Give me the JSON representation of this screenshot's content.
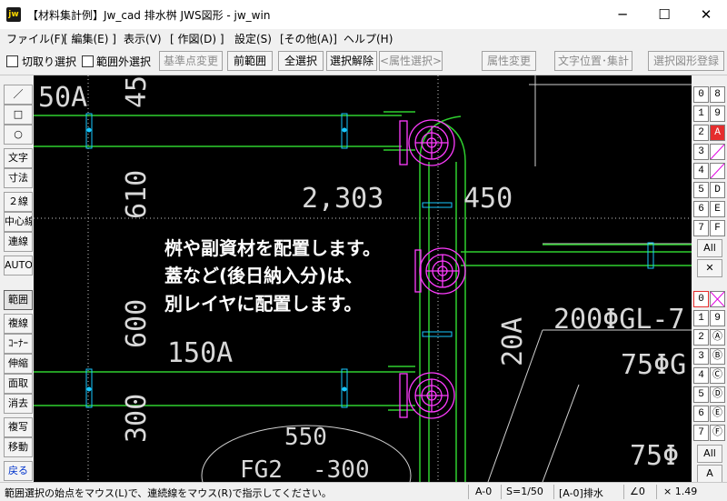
{
  "window": {
    "title": "【材料集計例】Jw_cad 排水桝 JWS図形 - jw_win",
    "app_icon": "jw",
    "controls": {
      "minimize": "─",
      "maximize": "☐",
      "close": "✕"
    }
  },
  "menu": [
    "ファイル(F)",
    "[ 編集(E) ]",
    "表示(V)",
    "[ 作図(D) ]",
    "設定(S)",
    "[その他(A)]",
    "ヘルプ(H)"
  ],
  "toolbar": {
    "checkbox_crop": "切取り選択",
    "checkbox_outside": "範囲外選択",
    "base_point": "基準点変更",
    "prev_range": "前範囲",
    "select_all": "全選択",
    "deselect": "選択解除",
    "attr_select": "<属性選択>",
    "attr_change": "属性変更",
    "text_pos": "文字位置･集計",
    "register": "選択図形登録"
  },
  "left_tools": [
    "／",
    "□",
    "○",
    "文字",
    "寸法",
    "２線",
    "中心線",
    "連線",
    "AUTO",
    "範囲",
    "複線",
    "ｺｰﾅｰ",
    "伸縮",
    "面取",
    "消去",
    "複写",
    "移動",
    "戻る"
  ],
  "right_groups": {
    "layer_groups": [
      "0",
      "1",
      "2",
      "3",
      "4",
      "5",
      "6",
      "7"
    ],
    "layer_groups_right": [
      "8",
      "9",
      "A",
      "",
      "",
      "D",
      "E",
      "F"
    ],
    "all_label": "All",
    "x_label": "✕",
    "layers": [
      "0",
      "1",
      "2",
      "3",
      "4",
      "5",
      "6",
      "7"
    ],
    "layers_right": [
      "",
      "9",
      "Ⓐ",
      "Ⓑ",
      "Ⓒ",
      "Ⓓ",
      "Ⓔ",
      "Ⓕ"
    ],
    "all_label_2": "All",
    "a_label": "A"
  },
  "drawing": {
    "texts": [
      "50A",
      "45",
      "610",
      "600",
      "300",
      "2,303",
      "450",
      "150A",
      "20A",
      "200ΦGL-7",
      "75ΦG",
      "75Φ",
      "550",
      "FG2",
      "-300"
    ],
    "note_lines": [
      "桝や副資材を配置します。",
      "蓋など(後日納入分)は、",
      "別レイヤに配置します。"
    ]
  },
  "status": {
    "message": "範囲選択の始点をマウス(L)で、連続線をマウス(R)で指示してください。",
    "layer": "A-0",
    "scale": "S=1/50",
    "layer_name": "[A-0]排水",
    "angle": "∠0",
    "zoom": "× 1.49"
  },
  "colors": {
    "pipe": "#2fd02f",
    "fitting": "#ff3cff",
    "connector": "#19c8ff",
    "dim_text": "#d8d8d8"
  }
}
